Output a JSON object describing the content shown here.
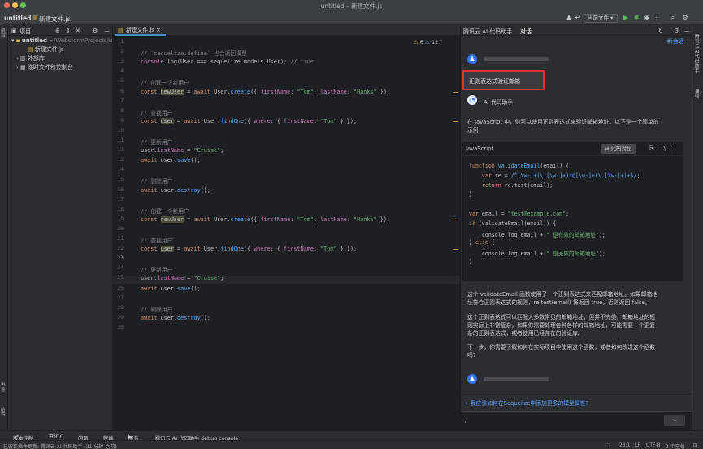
{
  "window": {
    "title": "untitled – 新建文件.js"
  },
  "toolbar": {
    "project_name": "untitled",
    "file_name": "新建文件.js",
    "run_config": "当前文件"
  },
  "left_strip": {
    "project_label": "项目",
    "bookmarks_label": "书签",
    "structure_label": "结构"
  },
  "project": {
    "header": "项目",
    "root": {
      "name": "untitled",
      "path": "~/WebstormProjects/un"
    },
    "file": "新建文件.js",
    "external": "外部库",
    "scratches": "临时文件和控制台"
  },
  "editor": {
    "tab": "新建文件.js",
    "warnings": "6",
    "weak_warnings": "12",
    "current_line": 23,
    "line_numbers": [
      "1",
      "2",
      "3",
      "4",
      "5",
      "6",
      "7",
      "8",
      "9",
      "10",
      "11",
      "12",
      "13",
      "14",
      "15",
      "16",
      "17",
      "18",
      "19",
      "20",
      "21",
      "22",
      "23",
      "24",
      "25",
      "26",
      "27",
      "28",
      "29",
      "30"
    ],
    "lines": [
      [],
      [
        {
          "t": "// `sequelize.define` 也会返回模型",
          "c": "c"
        }
      ],
      [
        {
          "t": "console",
          "c": "v"
        },
        {
          "t": ".log(",
          "c": ""
        },
        {
          "t": "User",
          "c": ""
        },
        {
          "t": " === ",
          "c": ""
        },
        {
          "t": "sequelize",
          "c": ""
        },
        {
          "t": ".models.",
          "c": ""
        },
        {
          "t": "User",
          "c": ""
        },
        {
          "t": "); ",
          "c": ""
        },
        {
          "t": "// true",
          "c": "c"
        }
      ],
      [],
      [
        {
          "t": "// 创建一个新用户",
          "c": "c"
        }
      ],
      [
        {
          "t": "const ",
          "c": "k"
        },
        {
          "t": "newUser",
          "c": "hl"
        },
        {
          "t": " = ",
          "c": ""
        },
        {
          "t": "await ",
          "c": "k"
        },
        {
          "t": "User",
          "c": ""
        },
        {
          "t": ".",
          "c": ""
        },
        {
          "t": "create",
          "c": "f"
        },
        {
          "t": "({ ",
          "c": ""
        },
        {
          "t": "firstName",
          "c": "v"
        },
        {
          "t": ": ",
          "c": ""
        },
        {
          "t": "\"Tom\"",
          "c": "s"
        },
        {
          "t": ", ",
          "c": ""
        },
        {
          "t": "lastName",
          "c": "v"
        },
        {
          "t": ": ",
          "c": ""
        },
        {
          "t": "\"Hanks\"",
          "c": "s"
        },
        {
          "t": " });",
          "c": ""
        }
      ],
      [],
      [
        {
          "t": "// 查找用户",
          "c": "c"
        }
      ],
      [
        {
          "t": "const ",
          "c": "k"
        },
        {
          "t": "user",
          "c": "hl"
        },
        {
          "t": " = ",
          "c": ""
        },
        {
          "t": "await ",
          "c": "k"
        },
        {
          "t": "User",
          "c": ""
        },
        {
          "t": ".",
          "c": ""
        },
        {
          "t": "findOne",
          "c": "f"
        },
        {
          "t": "({ ",
          "c": ""
        },
        {
          "t": "where",
          "c": "v"
        },
        {
          "t": ": { ",
          "c": ""
        },
        {
          "t": "firstName",
          "c": "v"
        },
        {
          "t": ": ",
          "c": ""
        },
        {
          "t": "\"Tom\"",
          "c": "s"
        },
        {
          "t": " } });",
          "c": ""
        }
      ],
      [],
      [
        {
          "t": "// 更新用户",
          "c": "c"
        }
      ],
      [
        {
          "t": "user",
          "c": ""
        },
        {
          "t": ".",
          "c": ""
        },
        {
          "t": "lastName",
          "c": "v"
        },
        {
          "t": " = ",
          "c": ""
        },
        {
          "t": "\"Cruise\"",
          "c": "s"
        },
        {
          "t": ";",
          "c": ""
        }
      ],
      [
        {
          "t": "await ",
          "c": "k"
        },
        {
          "t": "user",
          "c": ""
        },
        {
          "t": ".",
          "c": ""
        },
        {
          "t": "save",
          "c": "f"
        },
        {
          "t": "();",
          "c": ""
        }
      ],
      [],
      [
        {
          "t": "// 删除用户",
          "c": "c"
        }
      ],
      [
        {
          "t": "await ",
          "c": "k"
        },
        {
          "t": "user",
          "c": ""
        },
        {
          "t": ".",
          "c": ""
        },
        {
          "t": "destroy",
          "c": "f"
        },
        {
          "t": "();",
          "c": ""
        }
      ],
      [],
      [
        {
          "t": "// 创建一个新用户",
          "c": "c"
        }
      ],
      [
        {
          "t": "const ",
          "c": "k"
        },
        {
          "t": "newUser",
          "c": "hl"
        },
        {
          "t": " = ",
          "c": ""
        },
        {
          "t": "await ",
          "c": "k"
        },
        {
          "t": "User",
          "c": ""
        },
        {
          "t": ".",
          "c": ""
        },
        {
          "t": "create",
          "c": "f"
        },
        {
          "t": "({ ",
          "c": ""
        },
        {
          "t": "firstName",
          "c": "v"
        },
        {
          "t": ": ",
          "c": ""
        },
        {
          "t": "\"Tom\"",
          "c": "s"
        },
        {
          "t": ", ",
          "c": ""
        },
        {
          "t": "lastName",
          "c": "v"
        },
        {
          "t": ": ",
          "c": ""
        },
        {
          "t": "\"Hanks\"",
          "c": "s"
        },
        {
          "t": " });",
          "c": ""
        }
      ],
      [],
      [
        {
          "t": "// 查找用户",
          "c": "c"
        }
      ],
      [
        {
          "t": "const ",
          "c": "k"
        },
        {
          "t": "user",
          "c": "hl"
        },
        {
          "t": " = ",
          "c": ""
        },
        {
          "t": "await ",
          "c": "k"
        },
        {
          "t": "User",
          "c": ""
        },
        {
          "t": ".",
          "c": ""
        },
        {
          "t": "findOne",
          "c": "f"
        },
        {
          "t": "({ ",
          "c": ""
        },
        {
          "t": "where",
          "c": "v"
        },
        {
          "t": ": { ",
          "c": ""
        },
        {
          "t": "firstName",
          "c": "v"
        },
        {
          "t": ": ",
          "c": ""
        },
        {
          "t": "\"Tom\"",
          "c": "s"
        },
        {
          "t": " } });",
          "c": ""
        }
      ],
      [],
      [
        {
          "t": "// 更新用户",
          "c": "c"
        }
      ],
      [
        {
          "t": "user",
          "c": ""
        },
        {
          "t": ".",
          "c": ""
        },
        {
          "t": "lastName",
          "c": "v"
        },
        {
          "t": " = ",
          "c": ""
        },
        {
          "t": "\"Cruise\"",
          "c": "s"
        },
        {
          "t": ";",
          "c": ""
        }
      ],
      [
        {
          "t": "await ",
          "c": "k"
        },
        {
          "t": "user",
          "c": ""
        },
        {
          "t": ".",
          "c": ""
        },
        {
          "t": "save",
          "c": "f"
        },
        {
          "t": "();",
          "c": ""
        }
      ],
      [],
      [
        {
          "t": "// 删除用户",
          "c": "c"
        }
      ],
      [
        {
          "t": "await ",
          "c": "k"
        },
        {
          "t": "user",
          "c": ""
        },
        {
          "t": ".",
          "c": ""
        },
        {
          "t": "destroy",
          "c": "f"
        },
        {
          "t": "();",
          "c": ""
        }
      ],
      []
    ]
  },
  "ai": {
    "tab_title": "腾讯云 AI 代码助手",
    "tab_chat": "对话",
    "new_chat": "新会话",
    "user_question": "正则表达式验证邮箱",
    "assistant_name": "AI 代码助手",
    "intro": [
      "在 JavaScript 中，你可以使用正则表达式来验证邮箱地址。以下是一个简单的",
      "示例："
    ],
    "code_lang": "JavaScript",
    "code_compare": "代码对比",
    "code": [
      [
        {
          "t": "function ",
          "c": "k"
        },
        {
          "t": "validateEmail",
          "c": "f"
        },
        {
          "t": "(email) {",
          "c": ""
        }
      ],
      [
        {
          "t": "    var ",
          "c": "k"
        },
        {
          "t": "re = ",
          "c": ""
        },
        {
          "t": "/^[\\w-]+(\\.[\\w-]+)*@[\\w-]+(\\.[\\w-]+)+$/",
          "c": "f"
        },
        {
          "t": ";",
          "c": ""
        }
      ],
      [
        {
          "t": "    return ",
          "c": "k"
        },
        {
          "t": "re.test(email);",
          "c": ""
        }
      ],
      [
        {
          "t": "}",
          "c": ""
        }
      ],
      [],
      [
        {
          "t": "var ",
          "c": "k"
        },
        {
          "t": "email = ",
          "c": ""
        },
        {
          "t": "\"test@example.com\"",
          "c": "s"
        },
        {
          "t": ";",
          "c": ""
        }
      ],
      [
        {
          "t": "if ",
          "c": "k"
        },
        {
          "t": "(validateEmail(email)) {",
          "c": ""
        }
      ],
      [
        {
          "t": "    console.log(email + ",
          "c": ""
        },
        {
          "t": "\" 是有效的邮箱地址\"",
          "c": "s"
        },
        {
          "t": ");",
          "c": ""
        }
      ],
      [
        {
          "t": "} ",
          "c": ""
        },
        {
          "t": "else ",
          "c": "k"
        },
        {
          "t": "{",
          "c": ""
        }
      ],
      [
        {
          "t": "    console.log(email + ",
          "c": ""
        },
        {
          "t": "\" 是无效的邮箱地址\"",
          "c": "s"
        },
        {
          "t": ");",
          "c": ""
        }
      ],
      [
        {
          "t": "}",
          "c": ""
        }
      ]
    ],
    "explain1": [
      "这个 validateEmail 函数使用了一个正则表达式来匹配邮箱地址。如果邮箱地",
      "址符合正则表达式的规则，re.test(email) 将返回 true，否则返回 false。"
    ],
    "explain2": [
      "这个正则表达式可以匹配大多数常见的邮箱地址，但并不完美。邮箱地址的规",
      "则实际上非常复杂，如果你需要处理各种各样的邮箱地址，可能需要一个更复",
      "杂的正则表达式，或者使用已经存在的验证库。"
    ],
    "followup": [
      "下一步，你需要了解如何在实际项目中使用这个函数，或者如何改进这个函数",
      "吗?"
    ],
    "suggestion": "我应该如何在Sequelize中添加更多的模型属性?",
    "input_value": "/"
  },
  "right_strip": {
    "ai_label": "腾讯云 AI 代码助手",
    "notify_label": "通知"
  },
  "toolwindows": [
    "版本控制",
    "TODO",
    "问题",
    "终端",
    "服务",
    "腾讯云 AI 代码助手 debug console"
  ],
  "status": {
    "message": "已安装插件更新: 腾讯云 AI 代码助手 (31 分钟 之前)",
    "position": "23:1",
    "line_sep": "LF",
    "encoding": "UTF-8",
    "indent": "2 个空格"
  }
}
